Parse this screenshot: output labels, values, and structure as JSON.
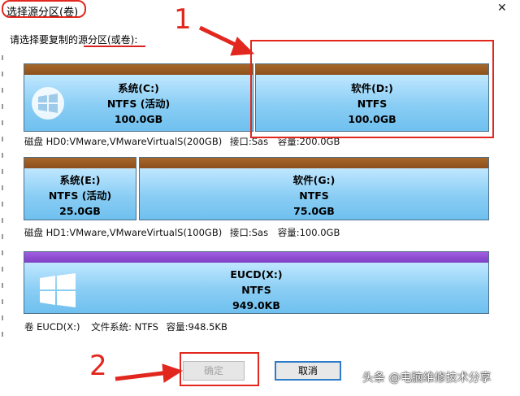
{
  "window": {
    "title": "选择源分区(卷)",
    "close_glyph": "✕"
  },
  "prompt": {
    "text": "请选择要复制的源分区(或卷):"
  },
  "disks": [
    {
      "partitions": [
        {
          "name": "系统(C:)",
          "fs": "NTFS (活动)",
          "size": "100.0GB",
          "bar_color": "#9a5a22",
          "has_windows_logo": true
        },
        {
          "name": "软件(D:)",
          "fs": "NTFS",
          "size": "100.0GB",
          "bar_color": "#9a5a22"
        }
      ],
      "info": {
        "disk": "磁盘 HD0:VMware,VMwareVirtualS(200GB)",
        "interface": "接口:Sas",
        "capacity": "容量:200.0GB"
      }
    },
    {
      "partitions": [
        {
          "name": "系统(E:)",
          "fs": "NTFS (活动)",
          "size": "25.0GB",
          "bar_color": "#9a5a22"
        },
        {
          "name": "软件(G:)",
          "fs": "NTFS",
          "size": "75.0GB",
          "bar_color": "#9a5a22"
        }
      ],
      "info": {
        "disk": "磁盘 HD1:VMware,VMwareVirtualS(100GB)",
        "interface": "接口:Sas",
        "capacity": "容量:100.0GB"
      }
    },
    {
      "partitions": [
        {
          "name": "EUCD(X:)",
          "fs": "NTFS",
          "size": "949.0KB",
          "bar_color": "#8e4bd0",
          "has_windows_logo": true
        }
      ],
      "info": {
        "volume": "卷 EUCD(X:)",
        "filesystem": "文件系统: NTFS",
        "capacity": "容量:948.5KB"
      }
    }
  ],
  "buttons": {
    "ok": "确定",
    "cancel": "取消"
  },
  "annotations": {
    "step1": "1",
    "step2": "2",
    "annotation_color": "#e2271f"
  },
  "watermark": "头条 @电脑维修技术分享"
}
